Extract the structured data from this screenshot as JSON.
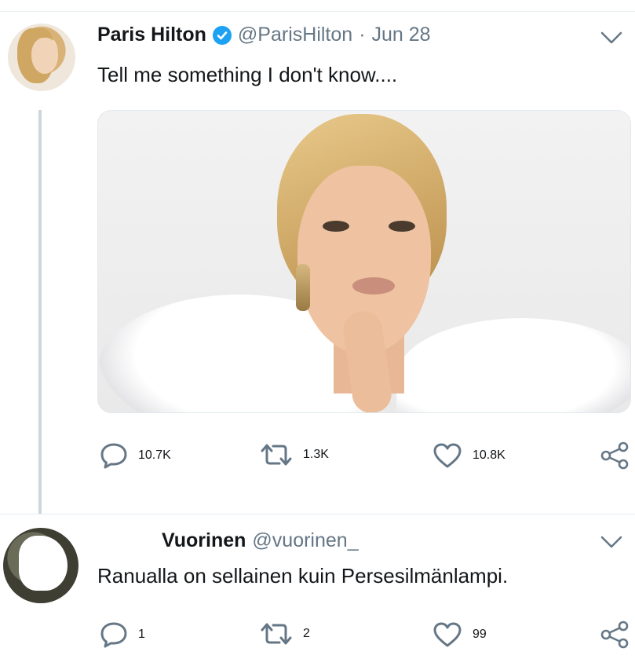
{
  "tweet": {
    "name": "Paris Hilton",
    "handle": "@ParisHilton",
    "separator": "·",
    "date": "Jun 28",
    "text": "Tell me something I don't know....",
    "counts": {
      "replies": "10.7K",
      "retweets": "1.3K",
      "likes": "10.8K"
    }
  },
  "reply": {
    "name": "Vuorinen",
    "handle": "@vuorinen_",
    "text": "Ranualla on sellainen kuin Persesilmänlampi.",
    "counts": {
      "replies": "1",
      "retweets": "2",
      "likes": "99"
    }
  },
  "colors": {
    "verified": "#1da1f2",
    "muted": "#657786",
    "text": "#14171a",
    "line": "#ccd6dd"
  },
  "icons": [
    "verified-badge-icon",
    "chevron-down-icon",
    "reply-icon",
    "retweet-icon",
    "like-icon",
    "share-icon"
  ]
}
